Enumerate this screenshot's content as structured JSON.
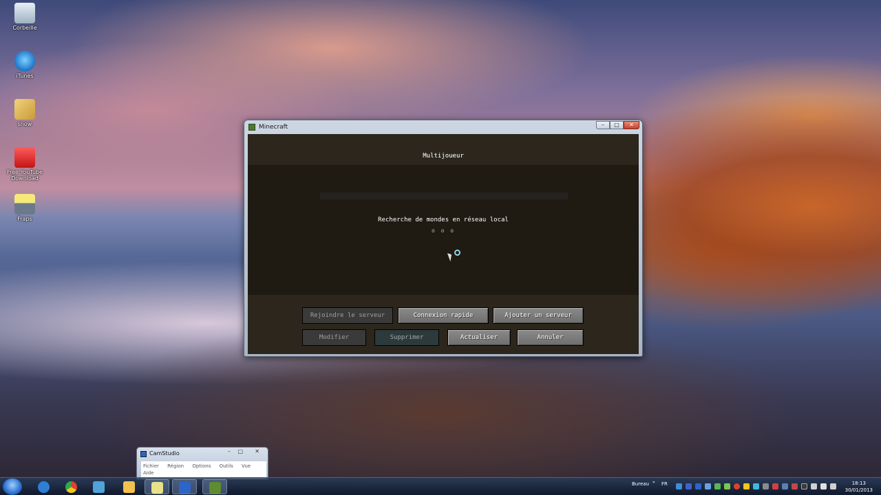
{
  "desktop": {
    "icons": [
      {
        "label": "Corbeille",
        "icon": "recycle-bin-icon"
      },
      {
        "label": "iTunes",
        "icon": "itunes-icon"
      },
      {
        "label": "snow",
        "icon": "folder-icon"
      },
      {
        "label": "Free YouTube Download",
        "icon": "youtube-download-icon"
      },
      {
        "label": "Fraps",
        "icon": "fraps-icon"
      }
    ]
  },
  "minecraft": {
    "window_title": "Minecraft",
    "screen_title": "Multijoueur",
    "scan_text": "Recherche de mondes en réseau local",
    "scan_dots": "o o o",
    "buttons": {
      "join": "Rejoindre le serveur",
      "direct_connect": "Connexion rapide",
      "add_server": "Ajouter un serveur",
      "edit": "Modifier",
      "delete": "Supprimer",
      "refresh": "Actualiser",
      "cancel": "Annuler"
    }
  },
  "camstudio": {
    "title": "CamStudio",
    "menu": [
      "Fichier",
      "Région",
      "Options",
      "Outils",
      "Vue"
    ],
    "menu_second_row": "Aide"
  },
  "taskbar": {
    "apps": [
      {
        "icon": "internet-explorer-icon",
        "color": "#2d7fd6"
      },
      {
        "icon": "chrome-icon",
        "color": "#e0412f"
      },
      {
        "icon": "network-icon",
        "color": "#4fa3d9"
      },
      {
        "icon": "file-explorer-icon",
        "color": "#f2c14e"
      },
      {
        "icon": "folder-notes-icon",
        "color": "#e8e08a"
      },
      {
        "icon": "camstudio-icon",
        "color": "#2d64c8"
      },
      {
        "icon": "minecraft-icon",
        "color": "#5e8c31"
      }
    ],
    "desktop_label": "Bureau",
    "language": "FR",
    "time": "18:13",
    "date": "30/01/2013"
  }
}
